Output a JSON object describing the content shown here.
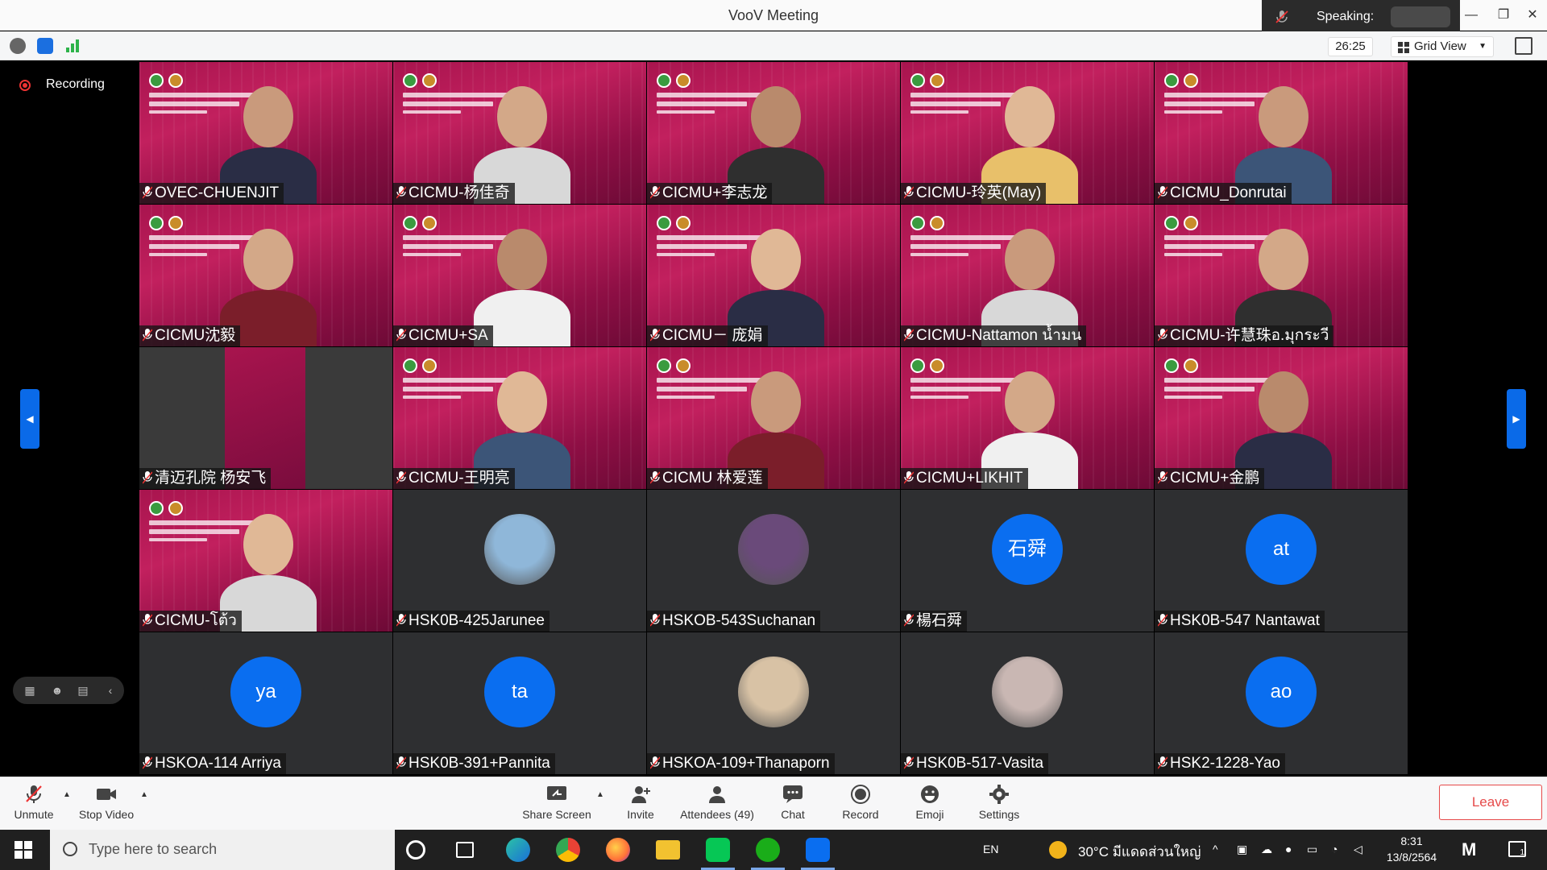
{
  "app": {
    "title": "VooV Meeting"
  },
  "speaking": {
    "label": "Speaking:"
  },
  "header": {
    "timer": "26:25",
    "view_mode": "Grid View"
  },
  "recording": {
    "label": "Recording"
  },
  "participants": [
    {
      "name": "OVEC-CHUENJIT",
      "kind": "video"
    },
    {
      "name": "CICMU-杨佳奇",
      "kind": "video"
    },
    {
      "name": "CICMU+李志龙",
      "kind": "video"
    },
    {
      "name": "CICMU-玲英(May)",
      "kind": "video"
    },
    {
      "name": "CICMU_Donrutai",
      "kind": "video"
    },
    {
      "name": "CICMU沈毅",
      "kind": "video"
    },
    {
      "name": "CICMU+SA",
      "kind": "video"
    },
    {
      "name": "CICMU－ 庞娟",
      "kind": "video"
    },
    {
      "name": "CICMU-Nattamon น้ำมน",
      "kind": "video"
    },
    {
      "name": "CICMU-许慧珠อ.มุกระวี",
      "kind": "video"
    },
    {
      "name": "清迈孔院  杨安飞",
      "kind": "video-partial"
    },
    {
      "name": "CICMU-王明亮",
      "kind": "video"
    },
    {
      "name": "CICMU 林爱莲",
      "kind": "video"
    },
    {
      "name": "CICMU+LIKHIT",
      "kind": "video"
    },
    {
      "name": "CICMU+金鹏",
      "kind": "video"
    },
    {
      "name": "CICMU-โต้ว",
      "kind": "video"
    },
    {
      "name": "HSK0B-425Jarunee",
      "kind": "photo",
      "color": "#8fb7d9"
    },
    {
      "name": "HSKOB-543Suchanan",
      "kind": "photo",
      "color": "#6a4a7a"
    },
    {
      "name": "楊石舜",
      "kind": "initials",
      "initials": "石舜"
    },
    {
      "name": "HSK0B-547 Nantawat",
      "kind": "initials",
      "initials": "at"
    },
    {
      "name": "HSKOA-114 Arriya",
      "kind": "initials",
      "initials": "ya"
    },
    {
      "name": "HSK0B-391+Pannita",
      "kind": "initials",
      "initials": "ta"
    },
    {
      "name": "HSKOA-109+Thanaporn",
      "kind": "photo",
      "color": "#d8c2a5"
    },
    {
      "name": "HSK0B-517-Vasita",
      "kind": "photo",
      "color": "#c9b7b3"
    },
    {
      "name": "HSK2-1228-Yao",
      "kind": "initials",
      "initials": "ao"
    }
  ],
  "toolbar": {
    "unmute": "Unmute",
    "stop_video": "Stop Video",
    "share_screen": "Share Screen",
    "invite": "Invite",
    "attendees": "Attendees (49)",
    "chat": "Chat",
    "record": "Record",
    "emoji": "Emoji",
    "settings": "Settings",
    "leave": "Leave"
  },
  "taskbar": {
    "search_placeholder": "Type here to search",
    "language": "EN",
    "weather": "30°C  มีแดดส่วนใหญ่",
    "time": "8:31",
    "date": "13/8/2564",
    "notification_count": "1"
  },
  "colors": {
    "accent": "#0a6ef0",
    "leave": "#e64a4a",
    "video_bg": "#a8144e"
  }
}
